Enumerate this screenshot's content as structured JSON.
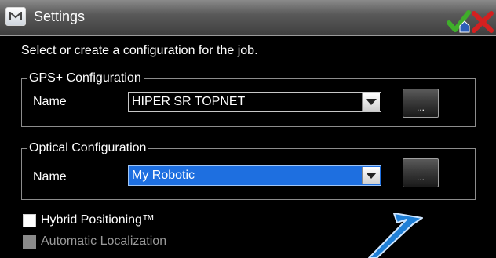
{
  "window": {
    "title": "Settings",
    "app_icon_letter": "M"
  },
  "instruction": "Select or create a configuration for the job.",
  "gps_group": {
    "legend": "GPS+ Configuration",
    "name_label": "Name",
    "selected_value": "HIPER SR TOPNET",
    "browse_label": "..."
  },
  "optical_group": {
    "legend": "Optical Configuration",
    "name_label": "Name",
    "selected_value": "My Robotic",
    "browse_label": "..."
  },
  "options": {
    "hybrid": {
      "label": "Hybrid Positioning™",
      "checked": false,
      "enabled": true
    },
    "auto_localization": {
      "label": "Automatic Localization",
      "checked": false,
      "enabled": false
    }
  },
  "icons": {
    "ok": "check-with-house-icon",
    "close": "red-x-icon",
    "annotation": "blue-arrow-icon"
  },
  "colors": {
    "selection": "#1e6fe0",
    "annotation_arrow": "#1f7fd6",
    "close_red": "#d42020",
    "ok_green": "#3fae2a"
  }
}
